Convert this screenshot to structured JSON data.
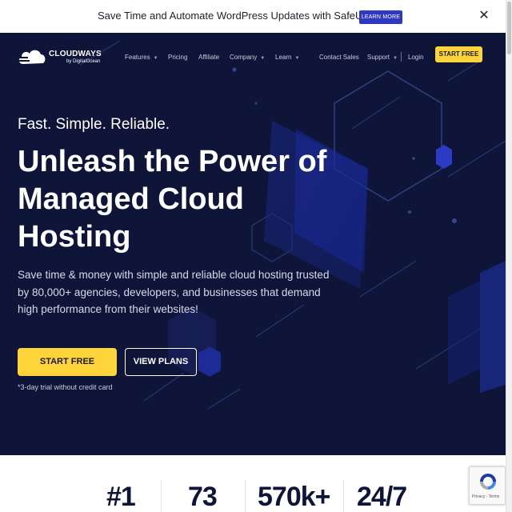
{
  "announcement": {
    "text": "Save Time and Automate WordPress Updates with SafeUpdates.",
    "cta_label": "LEARN MORE",
    "close_glyph": "✕"
  },
  "nav": {
    "logo_name": "CLOUDWAYS",
    "logo_sub": "by DigitalOcean",
    "items": [
      {
        "label": "Features",
        "caret": true
      },
      {
        "label": "Pricing",
        "caret": false
      },
      {
        "label": "Affiliate",
        "caret": false
      },
      {
        "label": "Company",
        "caret": true
      },
      {
        "label": "Learn",
        "caret": true
      },
      {
        "label": "Contact Sales",
        "caret": false
      },
      {
        "label": "Support",
        "caret": true
      },
      {
        "label": "Login",
        "caret": false
      }
    ],
    "cta_label": "START FREE",
    "caret_glyph": "▼"
  },
  "hero": {
    "tagline": "Fast. Simple. Reliable.",
    "headline_lines": [
      "Unleash the Power of",
      "Managed Cloud",
      "Hosting"
    ],
    "subtext": "Save time & money with simple and reliable cloud hosting trusted by 80,000+ agencies, developers, and businesses that demand high performance from their websites!",
    "primary_cta": "START FREE",
    "secondary_cta": "VIEW PLANS",
    "trial_note": "*3-day trial without credit card"
  },
  "stats": [
    "#1",
    "73",
    "570k+",
    "24/7"
  ],
  "recaptcha": {
    "footer": "Privacy - Terms"
  },
  "colors": {
    "hero_bg": "#0e1538",
    "accent_yellow": "#ffd43b",
    "learn_more_blue": "#2f39bf"
  }
}
